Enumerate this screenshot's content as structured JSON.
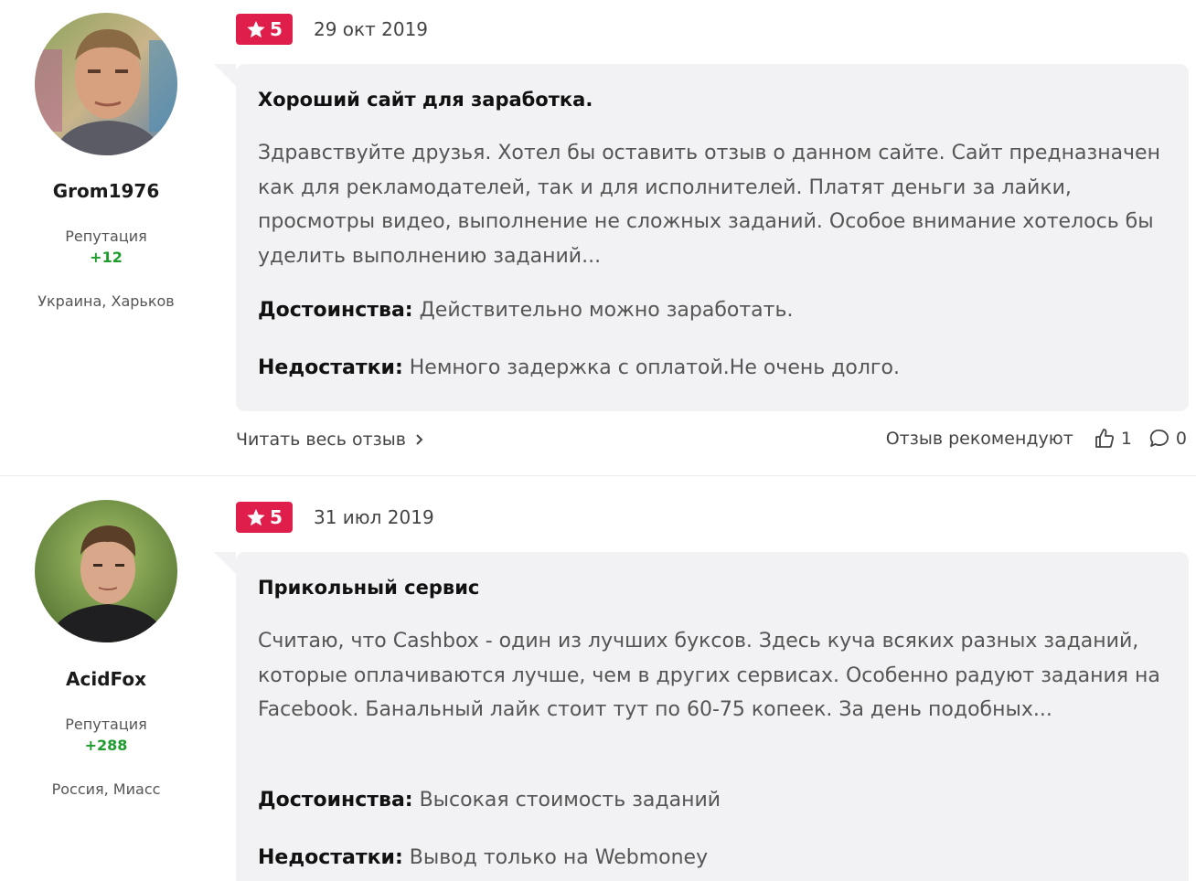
{
  "reviews": [
    {
      "author": {
        "username": "Grom1976",
        "reputation_label": "Репутация",
        "reputation_value": "+12",
        "location": "Украина, Харьков"
      },
      "rating": "5",
      "date": "29 окт 2019",
      "title": "Хороший сайт для заработка.",
      "text": "Здравствуйте друзья. Хотел бы оставить отзыв о данном сайте. Сайт предназначен как для рекламодателей, так и для исполнителей. Платят деньги за лайки, просмотры видео, выполнение не сложных заданий. Особое внимание хотелось бы уделить выполнению заданий...",
      "pros_label": "Достоинства:",
      "pros": "Действительно можно заработать.",
      "cons_label": "Недостатки:",
      "cons": "Немного задержка с оплатой.Не очень долго.",
      "read_more": "Читать весь отзыв",
      "recommend_label": "Отзыв рекомендуют",
      "likes": "1",
      "comments": "0"
    },
    {
      "author": {
        "username": "AcidFox",
        "reputation_label": "Репутация",
        "reputation_value": "+288",
        "location": "Россия, Миасс"
      },
      "rating": "5",
      "date": "31 июл 2019",
      "title": "Прикольный сервис",
      "text": "Считаю, что Cashbox - один из лучших буксов. Здесь куча всяких разных заданий, которые оплачиваются лучше, чем в других сервисах. Особенно радуют задания на Facebook. Банальный лайк стоит тут по 60-75 копеек. За день подобных...",
      "pros_label": "Достоинства:",
      "pros": "Высокая стоимость заданий",
      "cons_label": "Недостатки:",
      "cons": "Вывод только на Webmoney"
    }
  ],
  "colors": {
    "rating_badge": "#e01e4b",
    "reputation": "#1e9d2e",
    "card_bg": "#f2f2f4"
  },
  "icons": {
    "rating": "star-icon",
    "read_more": "chevron-right-icon",
    "like": "thumbs-up-icon",
    "comment": "comment-bubble-icon"
  }
}
